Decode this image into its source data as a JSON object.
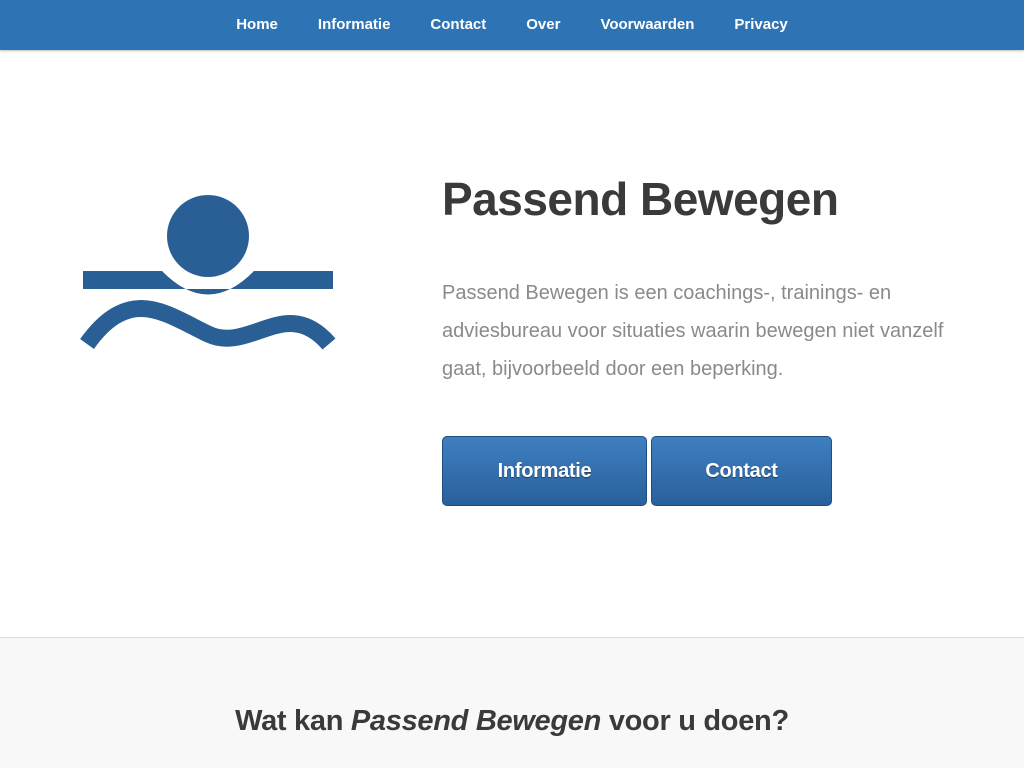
{
  "nav": {
    "items": [
      {
        "label": "Home"
      },
      {
        "label": "Informatie"
      },
      {
        "label": "Contact"
      },
      {
        "label": "Over"
      },
      {
        "label": "Voorwaarden"
      },
      {
        "label": "Privacy"
      }
    ]
  },
  "hero": {
    "logo_icon": "passend-bewegen-logo",
    "title": "Passend Bewegen",
    "description": "Passend Bewegen is een coachings-, trainings- en adviesbureau voor situaties waarin bewegen niet vanzelf gaat, bijvoorbeeld door een beperking.",
    "buttons": {
      "informatie": "Informatie",
      "contact": "Contact"
    }
  },
  "features": {
    "title_before": "Wat kan ",
    "title_emphasis": "Passend Bewegen",
    "title_after": " voor u doen?"
  },
  "colors": {
    "nav_bg": "#2e74b5",
    "logo": "#2a5f95",
    "button": "#2f6dab",
    "heading": "#3a3a3a",
    "body_text": "#8a8a8a",
    "features_bg": "#f8f8f8"
  }
}
